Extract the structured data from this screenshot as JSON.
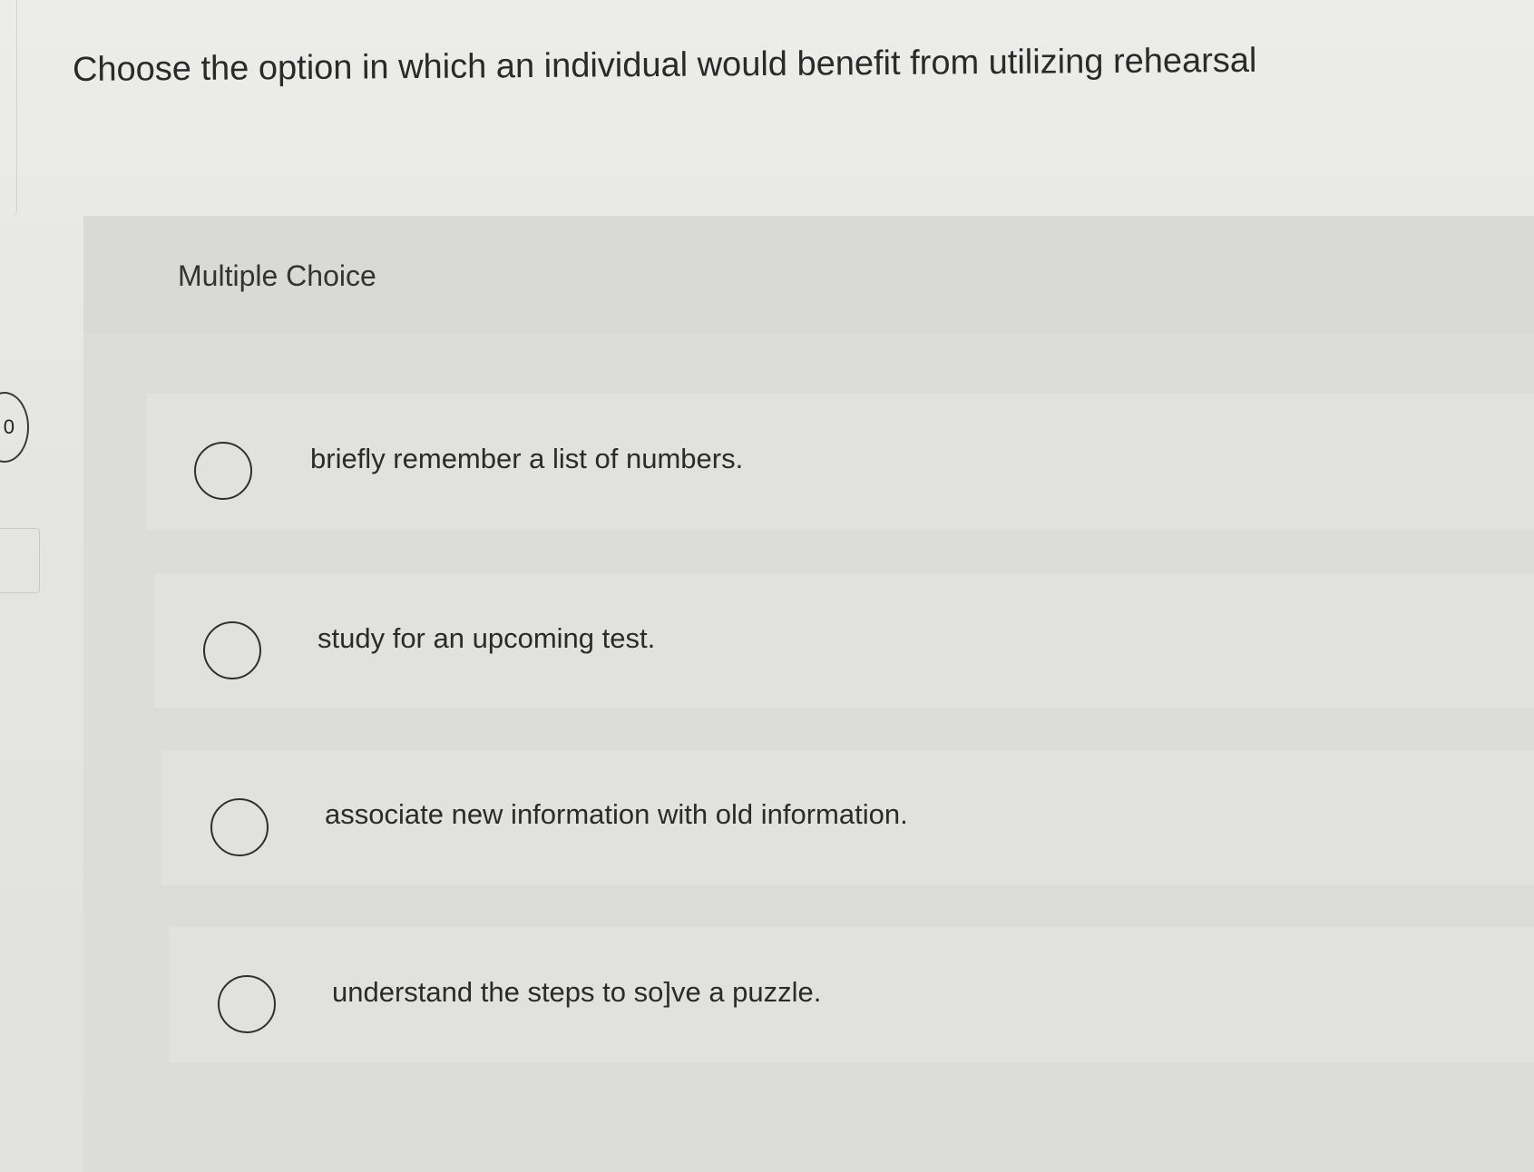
{
  "question": {
    "number": "0",
    "text": "Choose the option in which an individual would benefit from utilizing rehearsal"
  },
  "choice_panel": {
    "type_label": "Multiple Choice",
    "options": [
      {
        "label": "briefly remember a list of numbers."
      },
      {
        "label": "study for an upcoming test."
      },
      {
        "label": "associate new information with old information."
      },
      {
        "label": "understand the steps to so]ve a puzzle."
      }
    ]
  }
}
